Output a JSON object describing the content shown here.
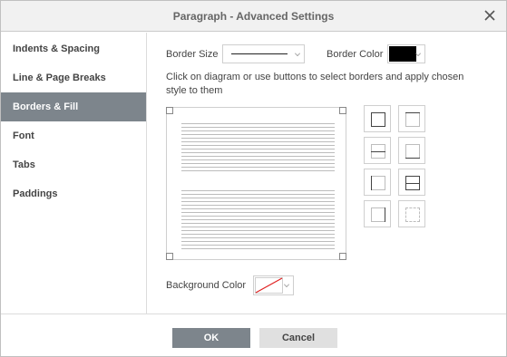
{
  "dialog": {
    "title": "Paragraph - Advanced Settings"
  },
  "sidebar": {
    "items": [
      {
        "label": "Indents & Spacing",
        "active": false
      },
      {
        "label": "Line & Page Breaks",
        "active": false
      },
      {
        "label": "Borders & Fill",
        "active": true
      },
      {
        "label": "Font",
        "active": false
      },
      {
        "label": "Tabs",
        "active": false
      },
      {
        "label": "Paddings",
        "active": false
      }
    ]
  },
  "borders": {
    "border_size_label": "Border Size",
    "border_color_label": "Border Color",
    "border_color_value": "#000000",
    "instructions": "Click on diagram or use buttons to select borders and apply chosen style to them",
    "background_color_label": "Background Color",
    "background_color_value": "none",
    "buttons": [
      "outer-border",
      "top-border",
      "inner-border",
      "bottom-border",
      "left-border",
      "all-borders",
      "right-border",
      "no-borders"
    ]
  },
  "footer": {
    "ok_label": "OK",
    "cancel_label": "Cancel"
  },
  "colors": {
    "accent": "#7d858c",
    "cancel_bg": "#e0e0e0",
    "no_color_slash": "#e02020"
  }
}
